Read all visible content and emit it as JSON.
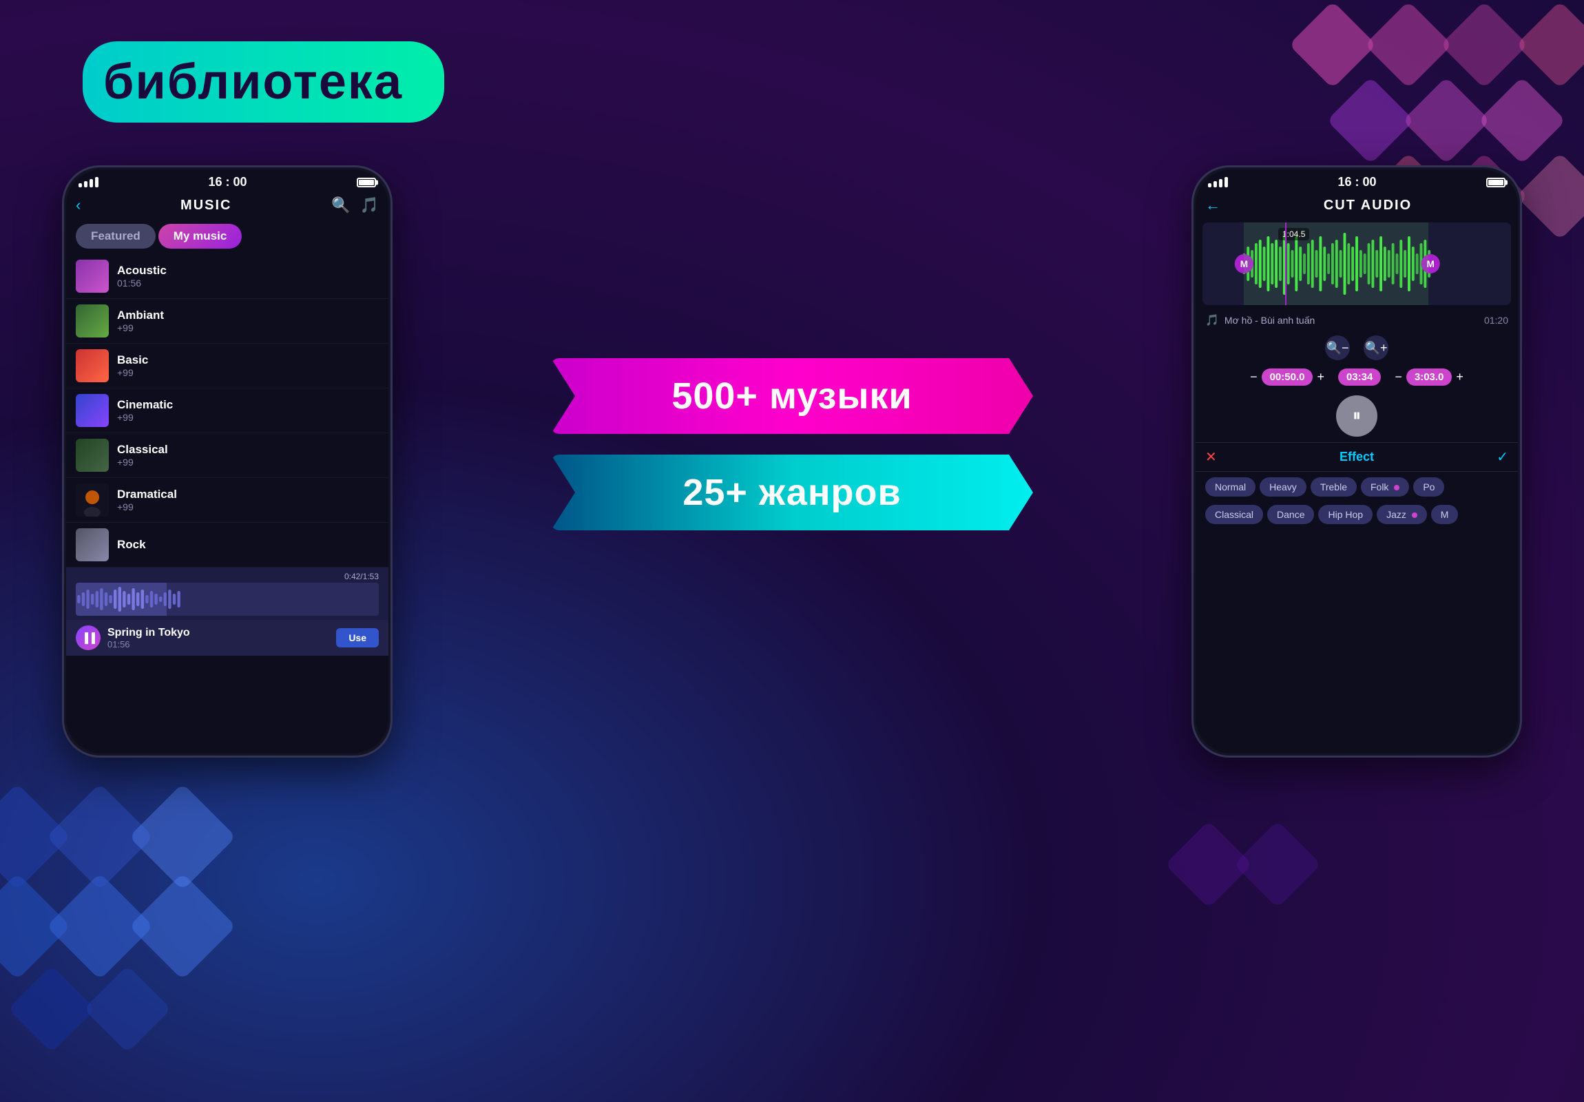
{
  "header": {
    "title": "библиотека"
  },
  "badges": {
    "music_count": "500+ музыки",
    "genre_count": "25+ жанров"
  },
  "phone1": {
    "status": {
      "time": "16 : 00"
    },
    "nav": {
      "title": "MUSIC",
      "back_label": "‹",
      "search_icon": "🔍",
      "playlist_icon": "🎵"
    },
    "tabs": {
      "featured": "Featured",
      "my_music": "My music"
    },
    "music_items": [
      {
        "name": "Acoustic",
        "count": "01:56",
        "thumb_class": "thumb-acoustic"
      },
      {
        "name": "Ambiant",
        "count": "+99",
        "thumb_class": "thumb-ambiant"
      },
      {
        "name": "Basic",
        "count": "+99",
        "thumb_class": "thumb-basic"
      },
      {
        "name": "Cinematic",
        "count": "+99",
        "thumb_class": "thumb-cinematic"
      },
      {
        "name": "Classical",
        "count": "+99",
        "thumb_class": "thumb-classical"
      },
      {
        "name": "Dramatical",
        "count": "+99",
        "thumb_class": "thumb-dramatical"
      },
      {
        "name": "Rock",
        "count": "",
        "thumb_class": "thumb-rock"
      }
    ],
    "now_playing": {
      "name": "Spring in Tokyo",
      "time": "01:56",
      "progress": "0:42/1:53",
      "use_label": "Use"
    }
  },
  "phone2": {
    "status": {
      "time": "16 : 00"
    },
    "nav": {
      "title": "CUT AUDIO",
      "back_icon": "←"
    },
    "track": {
      "name": "Mơ hồ - Bùi anh tuấn",
      "duration": "01:20",
      "time_marker": "1:04.5"
    },
    "controls": {
      "start_time": "00:50.0",
      "mid_time": "03:34",
      "end_time": "3:03.0"
    },
    "effect": {
      "title": "Effect",
      "cancel_icon": "✕",
      "confirm_icon": "✓",
      "chips_row1": [
        "Normal",
        "Heavy",
        "Treble",
        "Folk",
        "Po"
      ],
      "chips_row2": [
        "Classical",
        "Dance",
        "Hip Hop",
        "Jazz",
        "M"
      ]
    }
  }
}
